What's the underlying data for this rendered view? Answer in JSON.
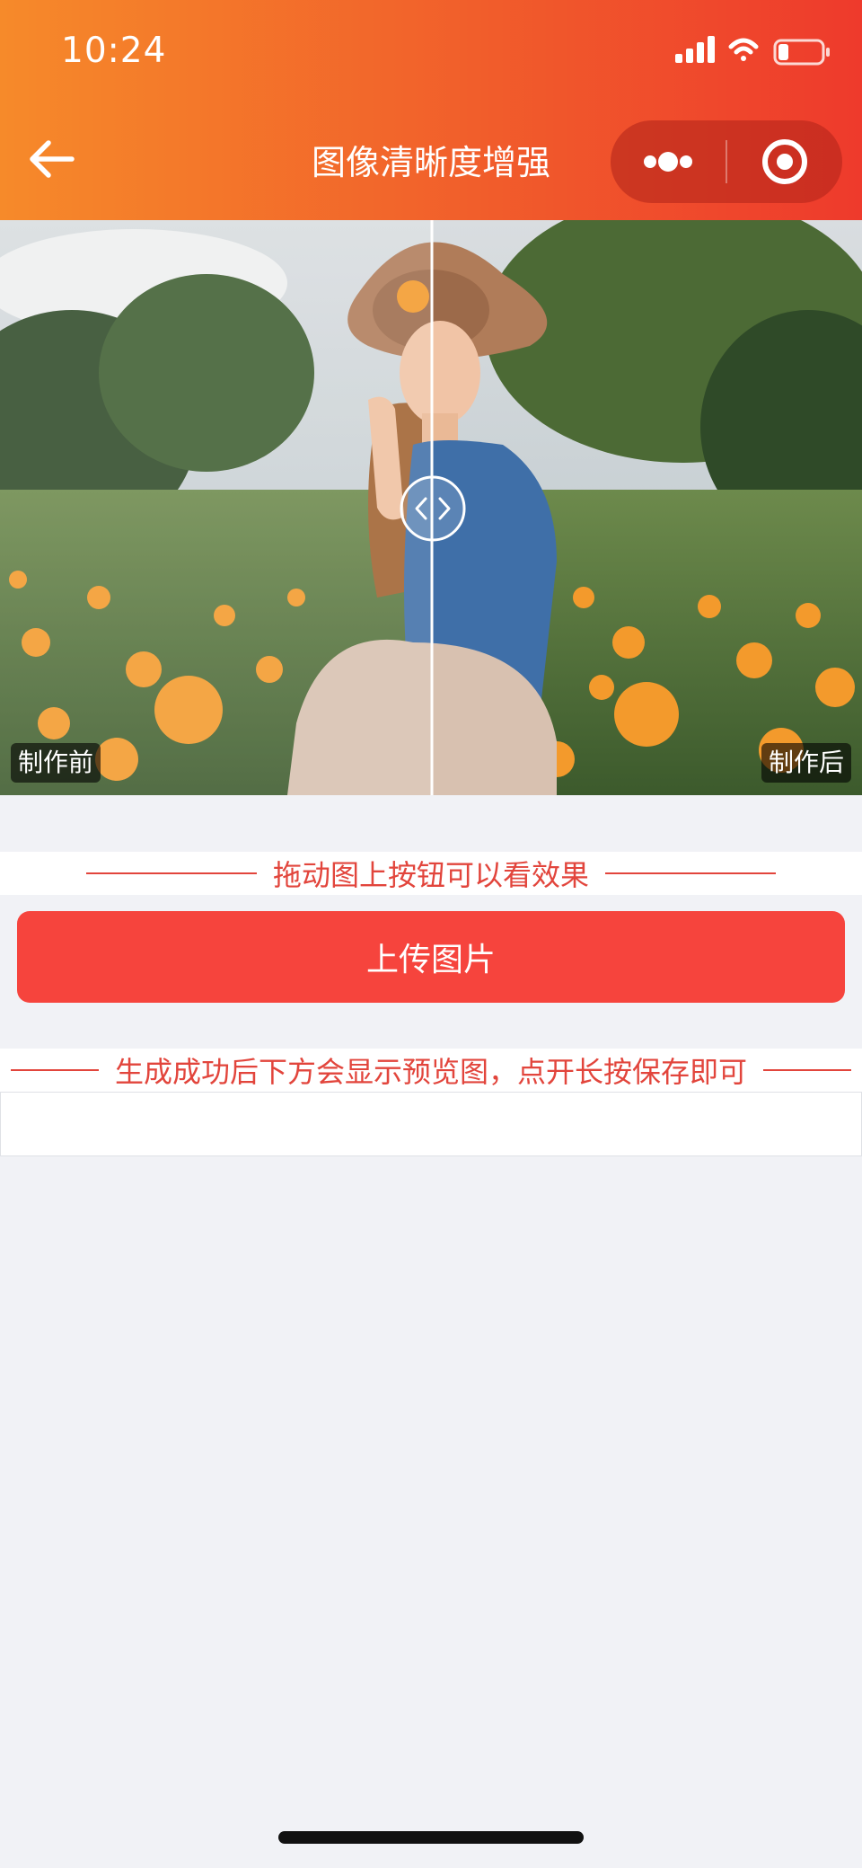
{
  "status_bar": {
    "time": "10:24"
  },
  "nav": {
    "title": "图像清晰度增强"
  },
  "compare": {
    "before_label": "制作前",
    "after_label": "制作后"
  },
  "hint_drag": "拖动图上按钮可以看效果",
  "upload_button": "上传图片",
  "hint_preview": "生成成功后下方会显示预览图，点开长按保存即可",
  "colors": {
    "header_start": "#f68a2a",
    "header_end": "#ee3a2c",
    "accent": "#f6443d",
    "hint_text": "#e2453c",
    "page_bg": "#f1f2f6"
  }
}
